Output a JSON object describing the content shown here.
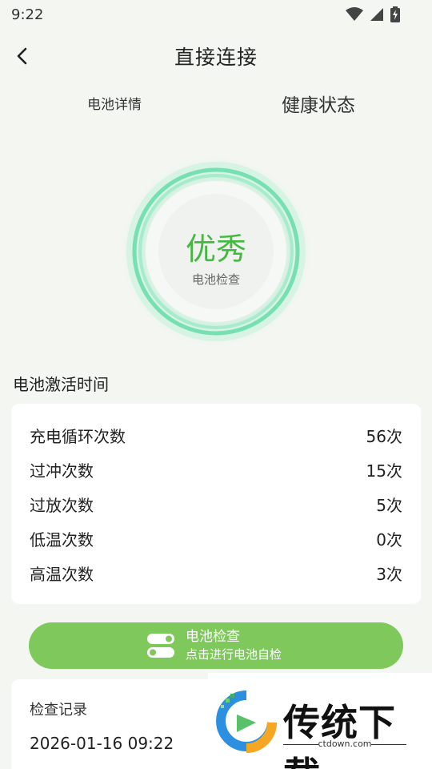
{
  "status_bar": {
    "time": "9:22",
    "icons": [
      "wifi-icon",
      "cell-signal-icon",
      "battery-charging-icon"
    ]
  },
  "header": {
    "title": "直接连接",
    "back_icon": "back-arrow-icon"
  },
  "tabs": [
    {
      "label": "电池详情",
      "active": false
    },
    {
      "label": "健康状态",
      "active": true
    }
  ],
  "gauge": {
    "status": "优秀",
    "subtitle": "电池检查"
  },
  "section": {
    "activation_title": "电池激活时间"
  },
  "stats": [
    {
      "label": "充电循环次数",
      "value": "56次"
    },
    {
      "label": "过冲次数",
      "value": "15次"
    },
    {
      "label": "过放次数",
      "value": "5次"
    },
    {
      "label": "低温次数",
      "value": "0次"
    },
    {
      "label": "高温次数",
      "value": "3次"
    }
  ],
  "check_button": {
    "title": "电池检查",
    "subtitle": "点击进行电池自检",
    "icon": "toggle-switch-icon"
  },
  "record": {
    "label": "检查记录",
    "time": "2026-01-16 09:22"
  },
  "watermark": {
    "text": "传统下载",
    "url": "ctdown.com"
  },
  "colors": {
    "accent": "#5dc98a",
    "status_green": "#45b842",
    "button": "#7ec85c",
    "background": "#f3f6f1"
  }
}
